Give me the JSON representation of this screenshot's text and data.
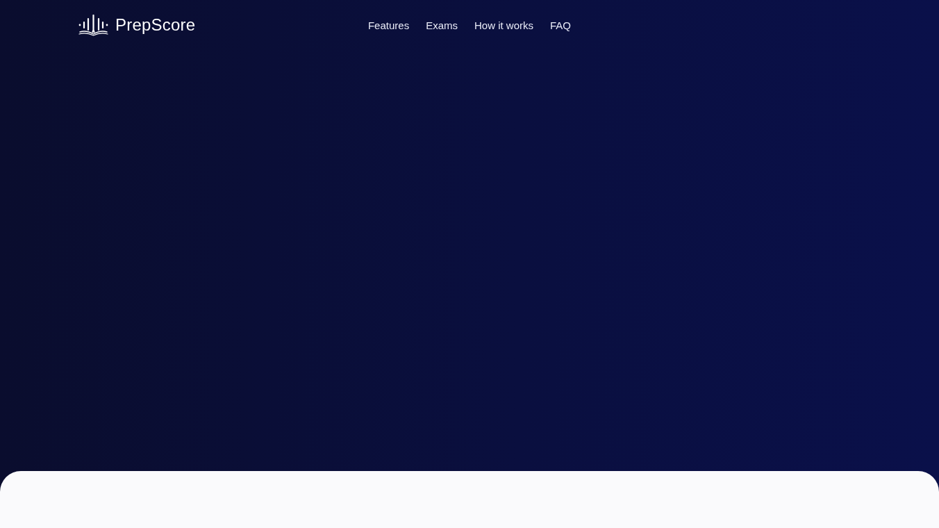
{
  "brand": {
    "name": "PrepScore"
  },
  "nav": {
    "links": [
      {
        "label": "Features"
      },
      {
        "label": "Exams"
      },
      {
        "label": "How it works"
      },
      {
        "label": "FAQ"
      }
    ]
  }
}
